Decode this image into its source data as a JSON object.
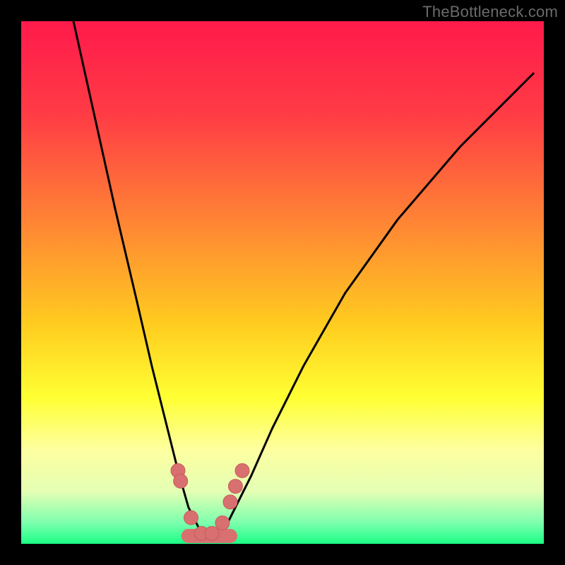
{
  "watermark": "TheBottleneck.com",
  "colors": {
    "frame": "#000000",
    "gradient_stops": [
      {
        "pos": 0.0,
        "color": "#ff1a4b"
      },
      {
        "pos": 0.18,
        "color": "#ff3c45"
      },
      {
        "pos": 0.4,
        "color": "#ff8a33"
      },
      {
        "pos": 0.58,
        "color": "#ffcc1f"
      },
      {
        "pos": 0.72,
        "color": "#ffff33"
      },
      {
        "pos": 0.82,
        "color": "#fdffa0"
      },
      {
        "pos": 0.9,
        "color": "#e4ffb4"
      },
      {
        "pos": 0.96,
        "color": "#7cffae"
      },
      {
        "pos": 1.0,
        "color": "#1aff84"
      }
    ],
    "curve": "#000000",
    "marker_fill": "#d87070",
    "marker_stroke": "#c85b5b"
  },
  "chart_data": {
    "type": "line",
    "title": "",
    "xlabel": "",
    "ylabel": "",
    "xlim": [
      0,
      100
    ],
    "ylim": [
      0,
      100
    ],
    "series": [
      {
        "name": "bottleneck-curve",
        "x": [
          10,
          14,
          18,
          22,
          25,
          27.5,
          30,
          32,
          34,
          35.5,
          37,
          39,
          41,
          44,
          48,
          54,
          62,
          72,
          84,
          98
        ],
        "y": [
          100,
          82,
          64,
          47,
          34,
          24,
          14,
          7,
          3,
          1,
          1,
          3,
          7,
          13,
          22,
          34,
          48,
          62,
          76,
          90
        ]
      }
    ],
    "markers": {
      "name": "highlighted-points",
      "x": [
        30,
        30.5,
        32.5,
        34.5,
        36.5,
        38.5,
        40,
        41,
        42.3
      ],
      "y": [
        14,
        12,
        5,
        2,
        2,
        4,
        8,
        11,
        14
      ]
    },
    "floor_segment": {
      "x": [
        32,
        40
      ],
      "y": [
        1.5,
        1.5
      ]
    }
  }
}
